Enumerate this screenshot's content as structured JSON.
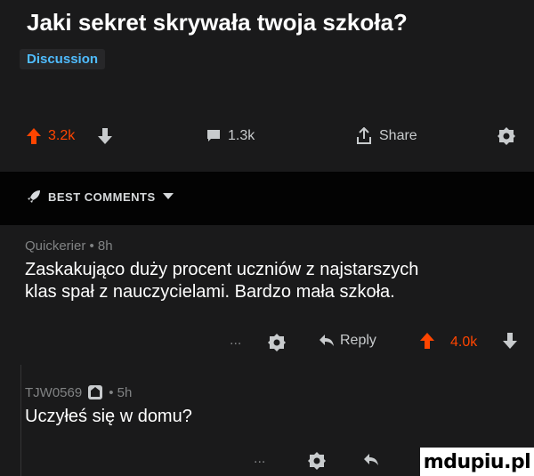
{
  "post": {
    "title": "Jaki sekret skrywała twoja szkoła?",
    "tag": "Discussion",
    "upvotes": "3.2k",
    "comments": "1.3k",
    "share_label": "Share"
  },
  "best_comments_label": "BEST COMMENTS",
  "comments": [
    {
      "meta": "Quickerier • 8h",
      "text_line1": "Zaskakująco duży procent uczniów z najstarszych",
      "text_line2": "klas spał z nauczycielami. Bardzo mała szkoła.",
      "more": "...",
      "reply_label": "Reply",
      "votes": "4.0k"
    },
    {
      "author": "TJW0569",
      "time": " • 5h",
      "text": "Uczyłeś się w domu?",
      "more": "..."
    }
  ],
  "watermark": "mdupiu.pl",
  "colors": {
    "accent": "#ff4500",
    "tag": "#4fbcff",
    "background": "#1a1a1b"
  }
}
